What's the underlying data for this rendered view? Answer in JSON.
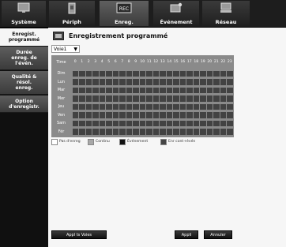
{
  "nav": {
    "tabs": [
      {
        "label": "Système",
        "icon": "monitor-icon",
        "state": "inactive"
      },
      {
        "label": "Périph",
        "icon": "device-icon",
        "state": "inactive"
      },
      {
        "label": "Enreg.",
        "icon": "rec-icon",
        "state": "active",
        "badge": "REC"
      },
      {
        "label": "Événement",
        "icon": "event-icon",
        "state": "inactive"
      },
      {
        "label": "Réseau",
        "icon": "network-icon",
        "state": "inactive"
      }
    ]
  },
  "sidebar": {
    "items": [
      {
        "label": "Enregist.\nprogrammé",
        "state": "active"
      },
      {
        "label": "Durée\nenreg. de\nl'évén.",
        "state": "inactive"
      },
      {
        "label": "Qualité &\nrésol.\nenreg.",
        "state": "inactive"
      },
      {
        "label": "Option\nd'enregistr.",
        "state": "inactive"
      }
    ]
  },
  "main": {
    "title": "Enregistrement programmé",
    "channel": {
      "value": "Voie1"
    },
    "grid": {
      "corner_label": "Time",
      "days": [
        "Dim",
        "Lun",
        "Mar",
        "Mer",
        "Jeu",
        "Ven",
        "Sam",
        "Fér"
      ],
      "hours": [
        "0",
        "1",
        "2",
        "3",
        "4",
        "5",
        "6",
        "7",
        "8",
        "9",
        "10",
        "11",
        "12",
        "13",
        "14",
        "15",
        "16",
        "17",
        "18",
        "19",
        "20",
        "21",
        "22",
        "23"
      ]
    },
    "legend": [
      {
        "label": "Pas d'enreg",
        "color": "#ffffff"
      },
      {
        "label": "Continu",
        "color": "#a8a8a8"
      },
      {
        "label": "Événement",
        "color": "#111111"
      },
      {
        "label": "Enr cont+évén",
        "color": "#444444"
      }
    ],
    "buttons": {
      "apply_all": "Appl ts Voies",
      "apply": "Appli",
      "cancel": "Annuler"
    }
  }
}
